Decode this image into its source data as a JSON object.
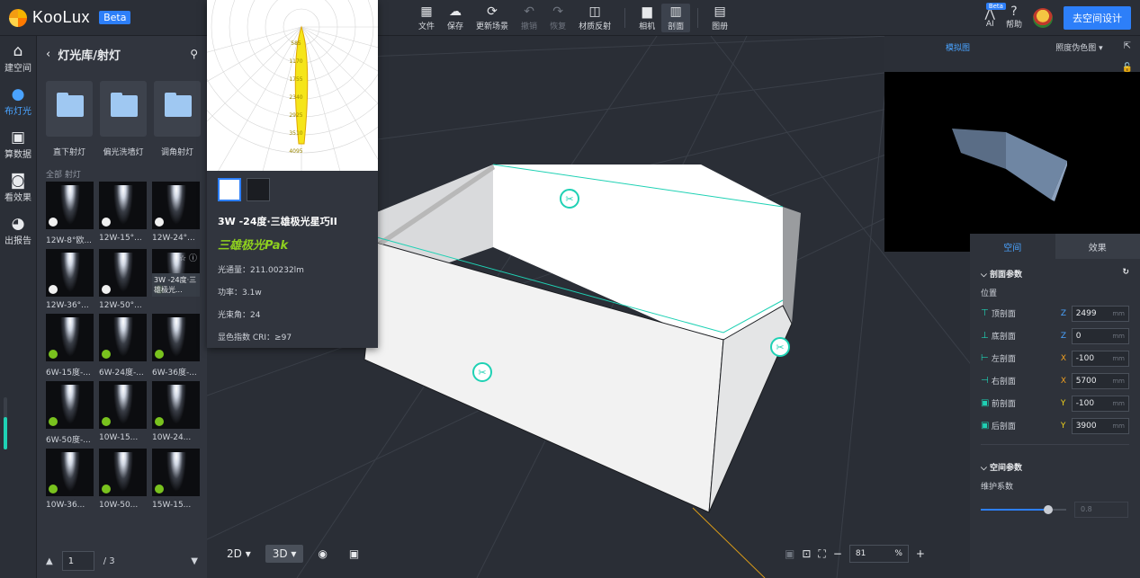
{
  "app": {
    "name": "KooLux",
    "badge": "Beta"
  },
  "toolbar": {
    "items": [
      {
        "label": "文件",
        "icon": "file-icon"
      },
      {
        "label": "保存",
        "icon": "save-cloud-icon"
      },
      {
        "label": "更新场景",
        "icon": "refresh-icon"
      },
      {
        "label": "撤销",
        "icon": "undo-icon"
      },
      {
        "label": "恢复",
        "icon": "redo-icon"
      },
      {
        "label": "材质反射",
        "icon": "material-icon"
      },
      {
        "label": "相机",
        "icon": "camera-icon"
      },
      {
        "label": "剖面",
        "icon": "section-icon"
      },
      {
        "label": "图册",
        "icon": "album-icon"
      }
    ],
    "ai_label": "AI",
    "ai_badge": "Beta",
    "help_label": "帮助",
    "cta": "去空间设计"
  },
  "leftnav": [
    "建空间",
    "布灯光",
    "算数据",
    "看效果",
    "出报告"
  ],
  "library": {
    "title": "灯光库/射灯",
    "folders": [
      "直下射灯",
      "偏光洗墙灯",
      "调角射灯"
    ],
    "section_label": "全部 射灯",
    "items": [
      "12W-8°欧...",
      "12W-15°...",
      "12W-24°...",
      "12W-36°...",
      "12W-50°...",
      "3W -24度·",
      "6W-15度-...",
      "6W-24度-...",
      "6W-36度-...",
      "6W-50度-...",
      "10W-15...",
      "10W-24...",
      "10W-36...",
      "10W-50...",
      "15W-15..."
    ],
    "hover_label": "3W -24度·三雄极光...",
    "page": "1",
    "pages": "/ 3"
  },
  "popup": {
    "polar_labels": [
      "585",
      "1170",
      "1755",
      "2340",
      "2925",
      "3510",
      "4095"
    ],
    "title": "3W -24度·三雄极光星巧II",
    "brand": "三雄极光Pak",
    "luminous": "光通量：211.00232lm",
    "power": "功率：3.1w",
    "beam": "光束角：24",
    "cri": "显色指数 CRI：≥97"
  },
  "viewbar": {
    "view2d": "2D",
    "view3d": "3D",
    "zoom": "81",
    "zoom_unit": "%"
  },
  "preview": {
    "tab1": "模拟图",
    "tab2": "照度伪色图"
  },
  "props": {
    "tab_space": "空间",
    "tab_effect": "效果",
    "section1": "剖面参数",
    "position": "位置",
    "rows": [
      {
        "label": "顶剖面",
        "axis": "Z",
        "value": "2499",
        "unit": "mm"
      },
      {
        "label": "底剖面",
        "axis": "Z",
        "value": "0",
        "unit": "mm"
      },
      {
        "label": "左剖面",
        "axis": "X",
        "value": "-100",
        "unit": "mm"
      },
      {
        "label": "右剖面",
        "axis": "X",
        "value": "5700",
        "unit": "mm"
      },
      {
        "label": "前剖面",
        "axis": "Y",
        "value": "-100",
        "unit": "mm"
      },
      {
        "label": "后剖面",
        "axis": "Y",
        "value": "3900",
        "unit": "mm"
      }
    ],
    "section2": "空间参数",
    "maintenance": "维护系数",
    "maintenance_value": "0.8"
  },
  "colors": {
    "accent": "#2d7ff9",
    "teal": "#1fd1b4",
    "axis_x": "#f0a020",
    "axis_y": "#f2d21b",
    "axis_z": "#4aa3ff"
  }
}
